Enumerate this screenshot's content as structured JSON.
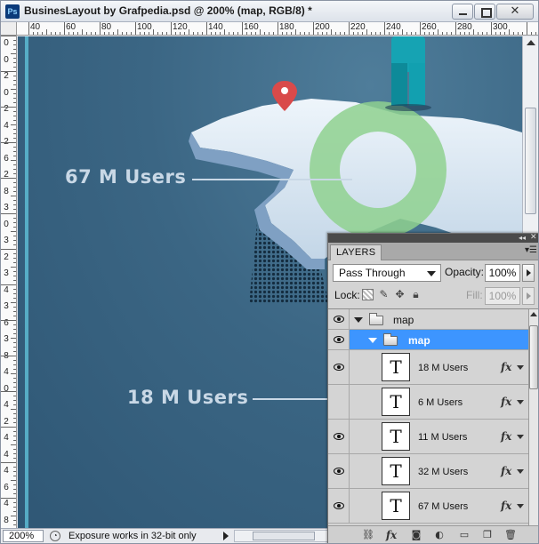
{
  "window": {
    "app_icon": "Ps",
    "title": "BusinesLayout by Grafpedia.psd @ 200% (map, RGB/8) *"
  },
  "ruler": {
    "top_labels": [
      "40",
      "60",
      "80",
      "100",
      "120",
      "140",
      "160",
      "180",
      "200",
      "220",
      "240",
      "260",
      "280",
      "300"
    ],
    "left_labels": [
      "0",
      "0",
      "2",
      "0",
      "2",
      "4",
      "2",
      "6",
      "2",
      "8",
      "3",
      "0",
      "3",
      "2",
      "3",
      "4",
      "3",
      "6",
      "3",
      "8",
      "4",
      "0",
      "4",
      "2",
      "4",
      "4",
      "4",
      "6",
      "4",
      "8"
    ]
  },
  "canvas": {
    "labels": [
      "67 M Users",
      "18 M Users"
    ],
    "colors": {
      "background": "#3b6684",
      "label_text": "#c9d8e6",
      "map_land": "#d8e6f2",
      "pin_red": "#d94a4a",
      "ring_green": "#8fd18f",
      "figure_teal": "#16a3b3"
    }
  },
  "statusbar": {
    "zoom": "200%",
    "message": "Exposure works in 32-bit only"
  },
  "layers_panel": {
    "tab": "LAYERS",
    "blend_mode": "Pass Through",
    "opacity_label": "Opacity:",
    "opacity_value": "100%",
    "lock_label": "Lock:",
    "fill_label": "Fill:",
    "fill_value": "100%",
    "groups": [
      {
        "name": "map",
        "selected": false
      },
      {
        "name": "map",
        "selected": true
      }
    ],
    "layers": [
      {
        "thumb": "T",
        "name": "18 M Users",
        "fx": "fx"
      },
      {
        "thumb": "T",
        "name": "6 M Users",
        "fx": "fx"
      },
      {
        "thumb": "T",
        "name": "11 M Users",
        "fx": "fx"
      },
      {
        "thumb": "T",
        "name": "32 M Users",
        "fx": "fx"
      },
      {
        "thumb": "T",
        "name": "67 M Users",
        "fx": "fx"
      }
    ],
    "bottom_icons": [
      "link-icon",
      "fx-icon",
      "mask-icon",
      "adjustment-icon",
      "folder-icon",
      "new-layer-icon",
      "trash-icon"
    ],
    "selected_color": "#3d95ff"
  }
}
